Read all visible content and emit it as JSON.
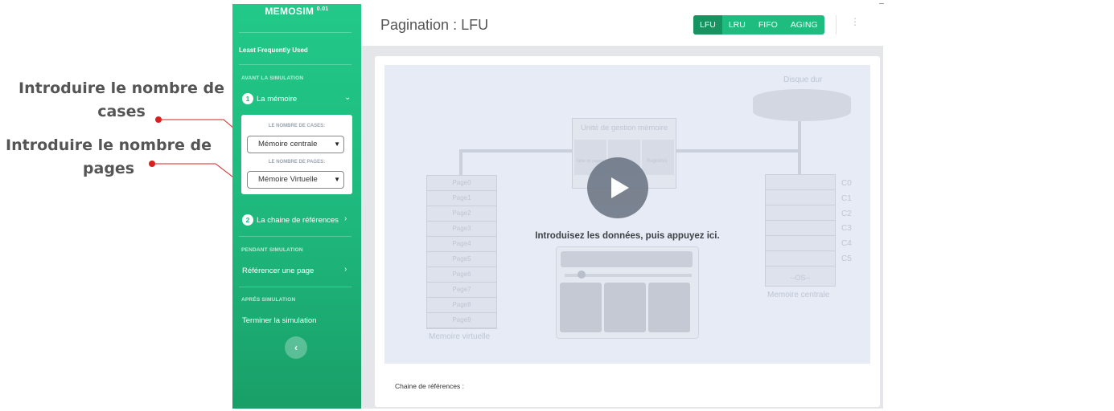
{
  "annotations": {
    "cases": "Introduire le nombre de cases",
    "pages": "Introduire le nombre de pages"
  },
  "sidebar": {
    "brand": "MEMOSIM",
    "version": "0.01",
    "algorithm_name": "Least Frequently Used",
    "before_heading": "AVANT LA SIMULATION",
    "step1": {
      "number": "1",
      "label": "La mémoire"
    },
    "panel": {
      "cases_label": "LE NOMBRE DE CASES:",
      "cases_value": "Mémoire centrale",
      "pages_label": "LE NOMBRE DE PAGES:",
      "pages_value": "Mémoire Virtuelle"
    },
    "step2": {
      "number": "2",
      "label": "La chaine de références"
    },
    "during_heading": "PENDANT SIMULATION",
    "reference_page": "Référencer une page",
    "after_heading": "APRÉS SIMULATION",
    "finish": "Terminer la simulation"
  },
  "header": {
    "title": "Pagination : LFU",
    "tabs": [
      {
        "label": "LFU",
        "active": true
      },
      {
        "label": "LRU",
        "active": false
      },
      {
        "label": "FIFO",
        "active": false
      },
      {
        "label": "AGING",
        "active": false
      }
    ]
  },
  "video": {
    "instruction": "Introduisez les données, puis appuyez ici.",
    "disk_label": "Disque dur",
    "mmu_title": "Unité de gestion mémoire",
    "mmu_cells": [
      "Table de pages",
      "",
      "Registres"
    ],
    "virtual_pages": [
      "Page0",
      "Page1",
      "Page2",
      "Page3",
      "Page4",
      "Page5",
      "Page6",
      "Page7",
      "Page8",
      "Page9"
    ],
    "virtual_label": "Memoire virtuelle",
    "frames": [
      "C0",
      "C1",
      "C2",
      "C3",
      "C4",
      "C5"
    ],
    "os_label": "--OS--",
    "central_label": "Memoire centrale"
  },
  "footer": {
    "chain_label": "Chaine de références :"
  },
  "colors": {
    "accent": "#1fbc7f",
    "accent_dark": "#17935f",
    "annotation_line": "#d9201d"
  }
}
